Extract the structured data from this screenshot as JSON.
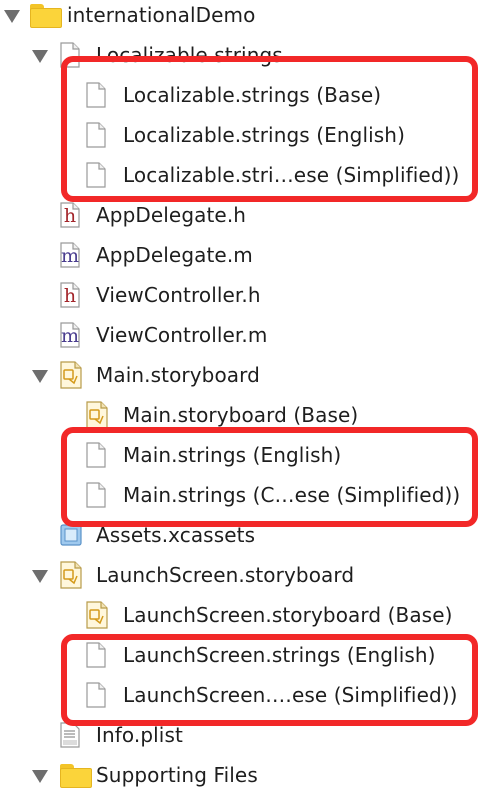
{
  "tree": [
    {
      "label": "internationalDemo",
      "icon": "folder-icon",
      "indent": 0,
      "expanded": true
    },
    {
      "label": "Localizable.strings",
      "icon": "strings-file-icon",
      "indent": 1,
      "expanded": true
    },
    {
      "label": "Localizable.strings (Base)",
      "icon": "strings-file-icon",
      "indent": 2
    },
    {
      "label": "Localizable.strings (English)",
      "icon": "strings-file-icon",
      "indent": 2
    },
    {
      "label": "Localizable.stri…ese (Simplified))",
      "icon": "strings-file-icon",
      "indent": 2
    },
    {
      "label": "AppDelegate.h",
      "icon": "header-file-icon",
      "indent": 1
    },
    {
      "label": "AppDelegate.m",
      "icon": "implementation-file-icon",
      "indent": 1
    },
    {
      "label": "ViewController.h",
      "icon": "header-file-icon",
      "indent": 1
    },
    {
      "label": "ViewController.m",
      "icon": "implementation-file-icon",
      "indent": 1
    },
    {
      "label": "Main.storyboard",
      "icon": "storyboard-icon",
      "indent": 1,
      "expanded": true
    },
    {
      "label": "Main.storyboard (Base)",
      "icon": "storyboard-icon",
      "indent": 2
    },
    {
      "label": "Main.strings (English)",
      "icon": "strings-file-icon",
      "indent": 2
    },
    {
      "label": "Main.strings (C…ese (Simplified))",
      "icon": "strings-file-icon",
      "indent": 2
    },
    {
      "label": "Assets.xcassets",
      "icon": "asset-catalog-icon",
      "indent": 1
    },
    {
      "label": "LaunchScreen.storyboard",
      "icon": "storyboard-icon",
      "indent": 1,
      "expanded": true
    },
    {
      "label": "LaunchScreen.storyboard (Base)",
      "icon": "storyboard-icon",
      "indent": 2
    },
    {
      "label": "LaunchScreen.strings (English)",
      "icon": "strings-file-icon",
      "indent": 2
    },
    {
      "label": "LaunchScreen.…ese (Simplified))",
      "icon": "strings-file-icon",
      "indent": 2
    },
    {
      "label": "Info.plist",
      "icon": "plist-file-icon",
      "indent": 1
    },
    {
      "label": "Supporting Files",
      "icon": "folder-icon",
      "indent": 1,
      "expanded": true
    }
  ],
  "colors": {
    "highlight": "#f22828",
    "folder": "#fbd43a",
    "header_letter": "#a3262b",
    "impl_letter": "#4a3d8f"
  }
}
